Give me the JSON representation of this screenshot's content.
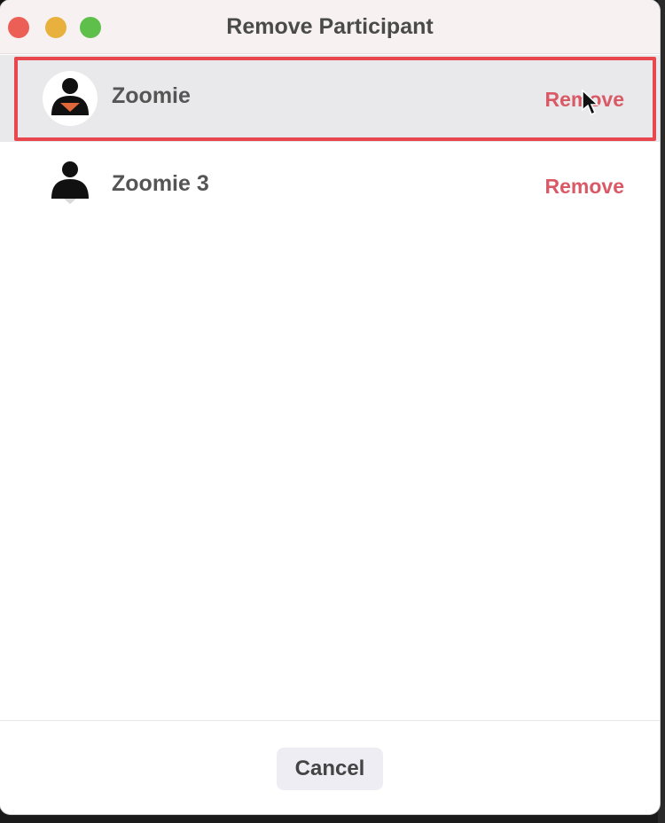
{
  "window": {
    "title": "Remove Participant"
  },
  "participants": [
    {
      "name": "Zoomie",
      "action_label": "Remove",
      "selected": true,
      "avatar_icon": "person-icon",
      "badge_color": "#e0673a"
    },
    {
      "name": "Zoomie 3",
      "action_label": "Remove",
      "selected": false,
      "avatar_icon": "person-icon"
    }
  ],
  "footer": {
    "cancel_label": "Cancel"
  },
  "colors": {
    "highlight": "#e8474e",
    "remove_text": "#d95a66",
    "close": "#ec5f57",
    "minimize": "#e8b13d",
    "maximize": "#5fbf4b"
  }
}
